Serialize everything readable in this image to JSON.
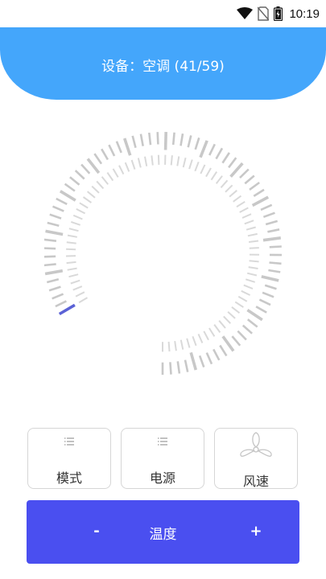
{
  "status_bar": {
    "time": "10:19",
    "icons": [
      "wifi-icon",
      "no-sim-icon",
      "battery-charging-icon"
    ]
  },
  "header": {
    "title": "设备：空调 (41/59)"
  },
  "dial": {
    "level": 0.0,
    "accent_color": "#5b62d6",
    "tick_color": "#c8c8c8"
  },
  "controls": {
    "mode_label": "模式",
    "power_label": "电源",
    "fan_label": "风速"
  },
  "temperature": {
    "minus_label": "-",
    "label": "温度",
    "plus_label": "+"
  },
  "colors": {
    "header": "#44a6fb",
    "temp_bar": "#4a4ff0"
  }
}
